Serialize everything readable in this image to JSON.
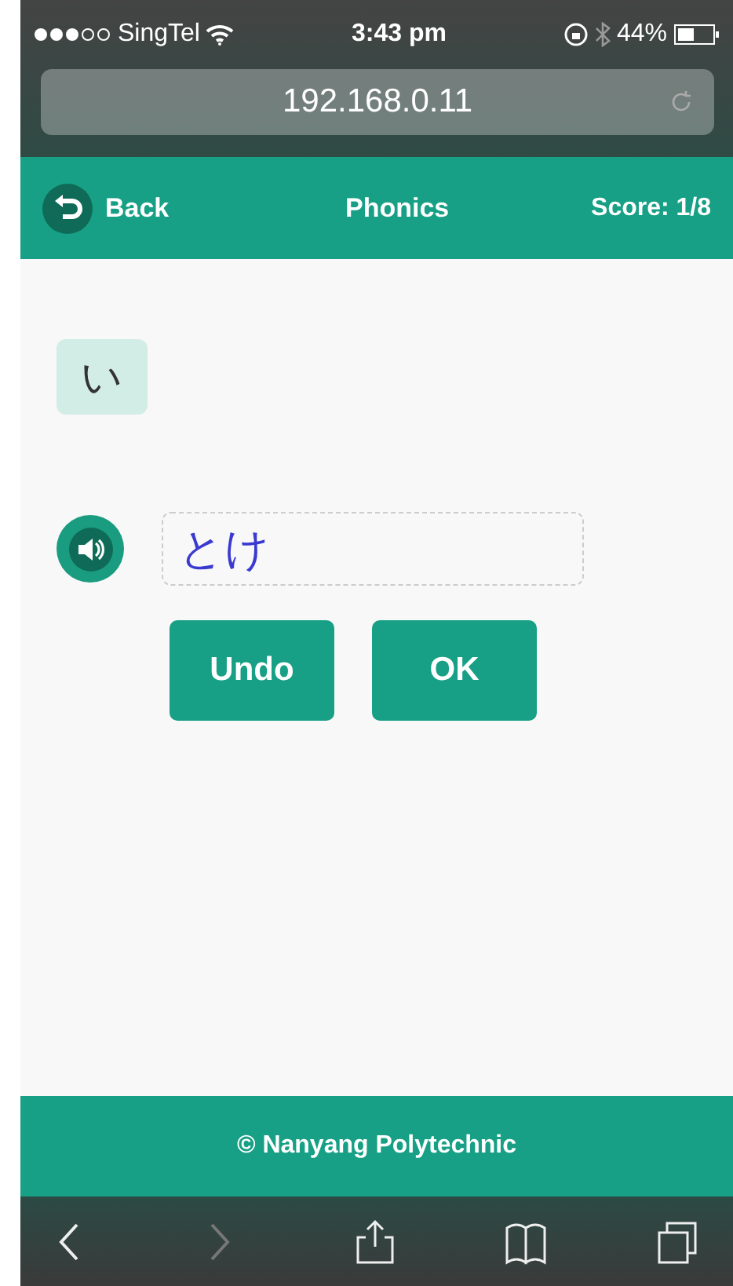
{
  "status_bar": {
    "carrier": "SingTel",
    "time": "3:43 pm",
    "battery": "44%"
  },
  "address_bar": {
    "url": "192.168.0.11"
  },
  "header": {
    "back": "Back",
    "title": "Phonics",
    "score": "Score: 1/8"
  },
  "question": {
    "character": "い"
  },
  "answer": {
    "value": "とけ"
  },
  "buttons": [
    {
      "label": "Undo"
    },
    {
      "label": "OK"
    }
  ],
  "footer": {
    "text": "© Nanyang Polytechnic"
  },
  "toolbar": [
    {
      "kind": "back",
      "disabled": false
    },
    {
      "kind": "forward",
      "disabled": true
    },
    {
      "kind": "share",
      "disabled": false
    },
    {
      "kind": "bookmarks",
      "disabled": false
    },
    {
      "kind": "tabs",
      "disabled": false
    }
  ]
}
